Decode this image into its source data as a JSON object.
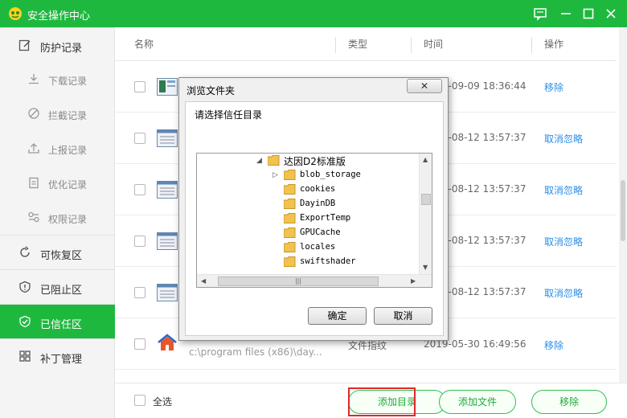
{
  "window": {
    "title": "安全操作中心"
  },
  "sidebar": {
    "items": [
      {
        "label": "防护记录"
      },
      {
        "label": "下载记录"
      },
      {
        "label": "拦截记录"
      },
      {
        "label": "上报记录"
      },
      {
        "label": "优化记录"
      },
      {
        "label": "权限记录"
      },
      {
        "label": "可恢复区"
      },
      {
        "label": "已阻止区"
      },
      {
        "label": "已信任区"
      },
      {
        "label": "补丁管理"
      }
    ]
  },
  "table": {
    "headers": {
      "name": "名称",
      "type": "类型",
      "time": "时间",
      "action": "操作"
    },
    "rows": [
      {
        "name": "",
        "path": "",
        "type": "",
        "time": "2019-09-09 18:36:44",
        "action": "移除"
      },
      {
        "name": "",
        "path": "",
        "type": "",
        "time": "2019-08-12 13:57:37",
        "action": "取消忽略"
      },
      {
        "name": "",
        "path": "",
        "type": "",
        "time": "2019-08-12 13:57:37",
        "action": "取消忽略"
      },
      {
        "name": "",
        "path": "",
        "type": "",
        "time": "2019-08-12 13:57:37",
        "action": "取消忽略"
      },
      {
        "name": "",
        "path": "",
        "type": "",
        "time": "2019-08-12 13:57:37",
        "action": "取消忽略"
      },
      {
        "name": "",
        "path": "c:\\program files (x86)\\day...",
        "type": "文件指纹",
        "time": "2019-05-30 16:49:56",
        "action": "移除"
      }
    ]
  },
  "footer": {
    "select_all": "全选",
    "add_dir": "添加目录",
    "add_file": "添加文件",
    "remove": "移除"
  },
  "dialog": {
    "title": "浏览文件夹",
    "close": "✕",
    "prompt": "请选择信任目录",
    "tree": [
      {
        "label": "达因D2标准版",
        "expanded": true
      },
      {
        "label": "blob_storage",
        "expandable": true
      },
      {
        "label": "cookies"
      },
      {
        "label": "DayinDB"
      },
      {
        "label": "ExportTemp"
      },
      {
        "label": "GPUCache"
      },
      {
        "label": "locales"
      },
      {
        "label": "swiftshader"
      }
    ],
    "ok": "确定",
    "cancel": "取消"
  },
  "colors": {
    "accent": "#1fb83f",
    "link": "#2b8ee8",
    "highlight": "#e02828",
    "folder": "#f2c24e"
  }
}
